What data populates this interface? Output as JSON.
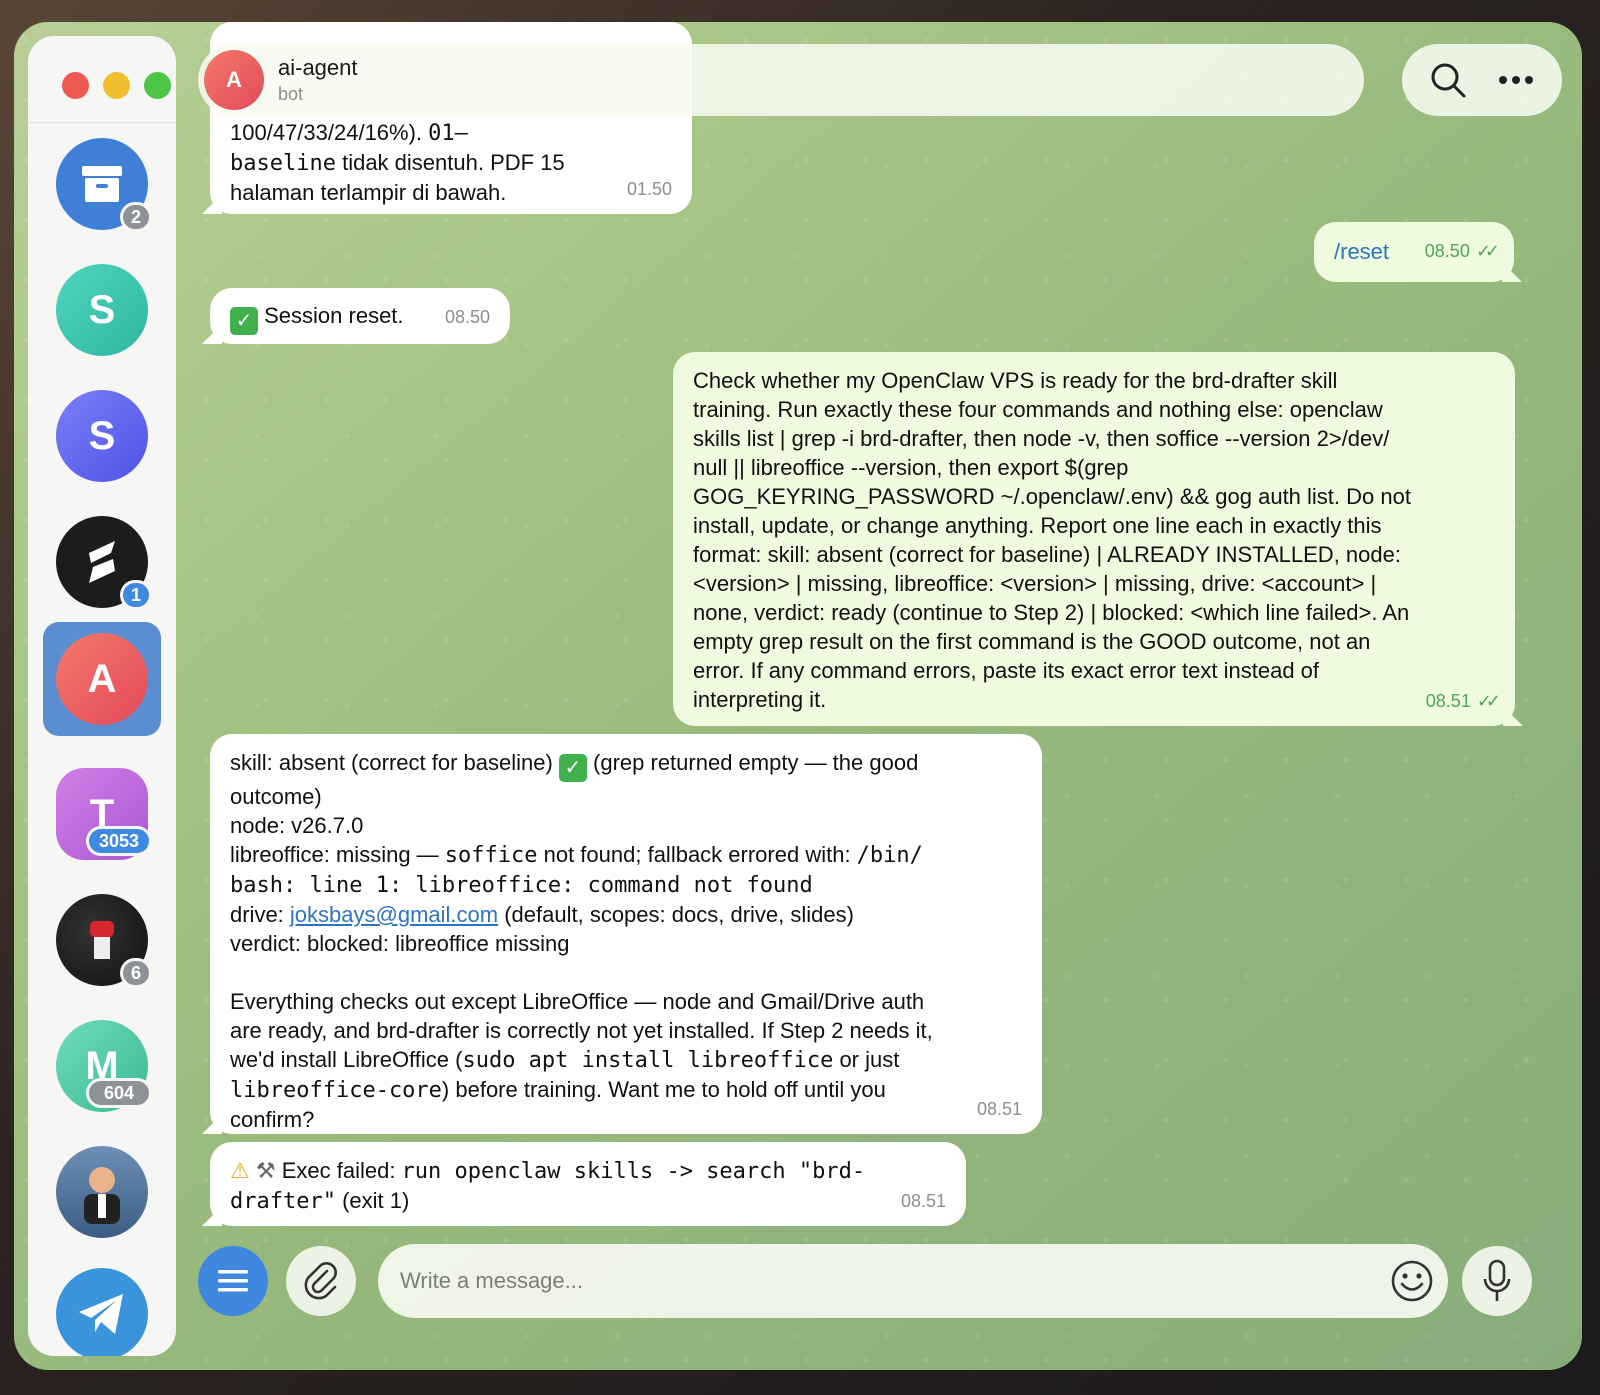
{
  "chat": {
    "name": "ai-agent",
    "subtitle": "bot",
    "avatar_letter": "A"
  },
  "sidebar": {
    "items": [
      {
        "name": "archive",
        "letter": "",
        "badge": "2",
        "color": "#3f7fd6"
      },
      {
        "name": "S",
        "letter": "S",
        "badge": "",
        "color": "#3cc7b0"
      },
      {
        "name": "S",
        "letter": "S",
        "badge": "",
        "color": "#5e66f0"
      },
      {
        "name": "logo-s",
        "letter": "S",
        "badge": "1",
        "color": "#1c1c1c"
      },
      {
        "name": "A",
        "letter": "A",
        "badge": "",
        "color": "#ec5a57"
      },
      {
        "name": "T",
        "letter": "T",
        "badge": "3053",
        "color": "#c06ad9"
      },
      {
        "name": "fist",
        "letter": "",
        "badge": "6",
        "color": "#1b1b1b"
      },
      {
        "name": "M",
        "letter": "M",
        "badge": "604",
        "color": "#54c9a8"
      },
      {
        "name": "person",
        "letter": "",
        "badge": "",
        "color": "#4a6d95"
      },
      {
        "name": "telegram",
        "letter": "",
        "badge": "",
        "color": "#3a94dc"
      }
    ]
  },
  "messages": {
    "m1": {
      "line1": "100/47/33/24/16%). ",
      "line1_code": "01–",
      "line2_code": "baseline",
      "line2": " tidak disentuh. PDF 15",
      "line3": "halaman terlampir di bawah.",
      "time": "01.50"
    },
    "m2": {
      "text": "/reset",
      "time": "08.50"
    },
    "m3": {
      "text": "Session reset.",
      "time": "08.50"
    },
    "m4": {
      "lines": [
        "Check whether my OpenClaw VPS is ready for the brd-drafter skill",
        "training. Run exactly these four commands and nothing else: openclaw",
        "skills list | grep -i brd-drafter, then node -v, then soffice --version 2>/dev/",
        "null || libreoffice --version, then export $(grep",
        "GOG_KEYRING_PASSWORD ~/.openclaw/.env) && gog auth list. Do not",
        "install, update, or change anything. Report one line each in exactly this",
        "format: skill: absent (correct for baseline) | ALREADY INSTALLED, node:",
        "<version> | missing, libreoffice: <version> | missing, drive: <account> |",
        "none, verdict: ready (continue to Step 2) | blocked: <which line failed>. An",
        "empty grep result on the first command is the GOOD outcome, not an",
        "error. If any command errors, paste its exact error text instead of",
        "interpreting it."
      ],
      "time": "08.51"
    },
    "m5": {
      "l1a": "skill: absent (correct for baseline) ",
      "l1b": " (grep returned empty — the good",
      "l2": "outcome)",
      "l3": "node: v26.7.0",
      "l4a": "libreoffice: missing — ",
      "l4code": "soffice",
      "l4b": " not found; fallback errored with: ",
      "l4code2": "/bin/",
      "l5code": "bash: line 1: libreoffice: command not found",
      "l6a": "drive: ",
      "l6link": "joksbays@gmail.com",
      "l6b": " (default, scopes: docs, drive, slides)",
      "l7": "verdict: blocked: libreoffice missing",
      "p1": "Everything checks out except LibreOffice — node and Gmail/Drive auth",
      "p2": "are ready, and brd-drafter is correctly not yet installed. If Step 2 needs it,",
      "p3a": "we'd install LibreOffice (",
      "p3code": "sudo apt install libreoffice",
      "p3b": " or just",
      "p4code": "libreoffice-core",
      "p4b": ") before training. Want me to hold off until you",
      "p5": "confirm?",
      "time": "08.51"
    },
    "m6": {
      "prefix": " Exec failed: ",
      "code1": "run openclaw skills -> search \"brd-",
      "code2": "drafter\"",
      "suffix": " (exit 1)",
      "time": "08.51"
    }
  },
  "composer": {
    "placeholder": "Write a message..."
  },
  "colors": {
    "accent": "#3f87df",
    "outgoing_bubble": "#eefbdf",
    "read_checks": "#4fa65a"
  }
}
